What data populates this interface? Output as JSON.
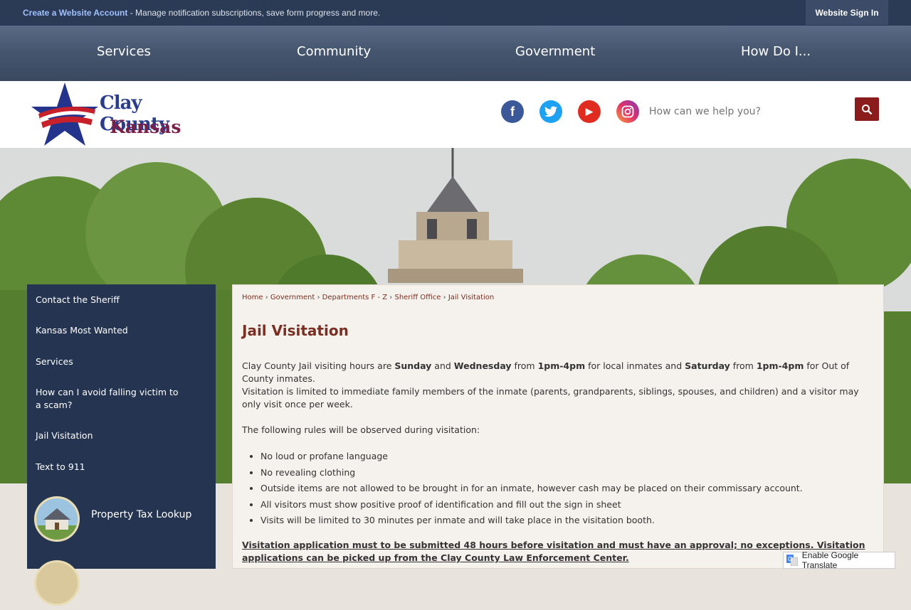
{
  "topbar": {
    "account_link": "Create a Website Account",
    "account_text": " - Manage notification subscriptions, save form progress and more.",
    "signin": "Website Sign In"
  },
  "nav": {
    "services": "Services",
    "community": "Community",
    "government": "Government",
    "howdoi": "How Do I..."
  },
  "logo": {
    "line1": "Clay County",
    "line2": "Kansas"
  },
  "search": {
    "placeholder": "How can we help you?"
  },
  "sidebar": {
    "items": [
      "Contact the Sheriff",
      "Kansas Most Wanted",
      "Services",
      "How can I avoid falling victim to a scam?",
      "Jail Visitation",
      "Text to 911"
    ],
    "quick": [
      "Property Tax Lookup"
    ]
  },
  "breadcrumb": [
    "Home",
    "Government",
    "Departments F - Z",
    "Sheriff Office",
    "Jail Visitation"
  ],
  "breadcrumb_sep": " › ",
  "title": "Jail Visitation",
  "p1": {
    "a": "Clay County Jail visiting hours are ",
    "b": "Sunday",
    "c": " and ",
    "d": "Wednesday",
    "e": " from ",
    "f": "1pm-4pm",
    "g": " for local inmates and ",
    "h": "Saturday",
    "i": " from ",
    "j": "1pm-4pm",
    "k": " for Out of County inmates."
  },
  "p2": "Visitation is limited to immediate family members of the inmate (parents, grandparents, siblings, spouses, and children) and a visitor may only visit once per week.",
  "p3": "The following rules will be observed during visitation:",
  "rules": [
    "No loud or profane language",
    "No revealing clothing",
    "Outside items are not allowed to be brought in for an inmate, however cash may be placed on their commissary account.",
    "All visitors must show positive proof of identification and fill out the sign in sheet",
    "Visits will be limited to 30 minutes per inmate and will take place in the visitation booth."
  ],
  "notice": "Visitation application must to be submitted 48 hours before visitation and must have an approval; no exceptions.  Visitation applications can be picked up from the Clay County Law Enforcement Center.",
  "translate": "Enable Google Translate",
  "colors": {
    "navy": "#253450",
    "accent": "#7a2f22",
    "search": "#8a1c1c"
  },
  "icons": {
    "facebook": "f",
    "youtube": "▶"
  }
}
